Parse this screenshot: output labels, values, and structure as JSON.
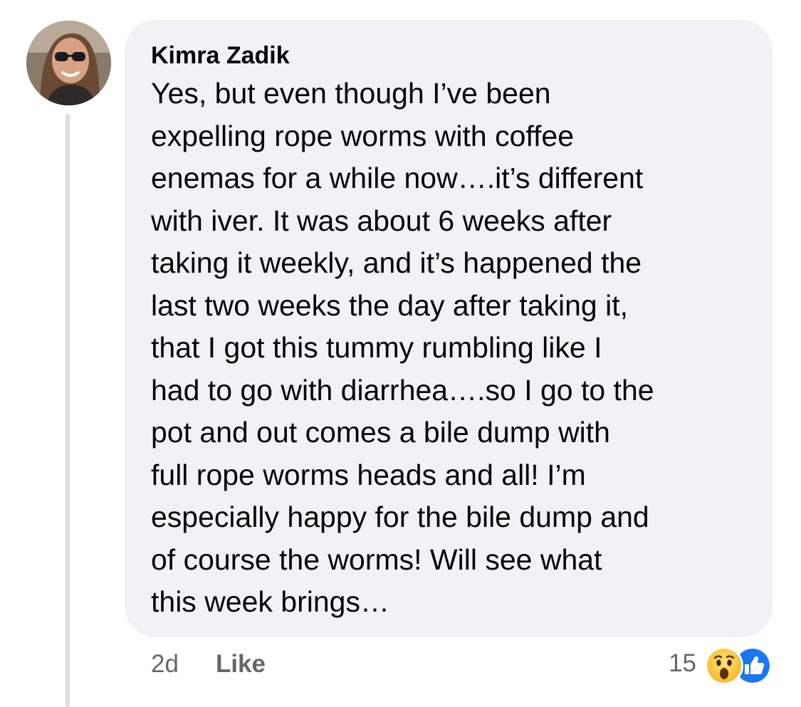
{
  "comment": {
    "author": "Kimra Zadik",
    "text": "Yes, but even though I’ve been\nexpelling rope worms with coffee\nenemas for a while now….it’s different\nwith iver.  It was about 6 weeks after\ntaking it weekly, and it’s happened the\nlast two weeks the day after taking it,\nthat I got this tummy rumbling like I\nhad to go with diarrhea….so I go to the\npot and out comes a bile dump with\nfull rope worms heads and all!  I’m\nespecially happy for the bile dump and\nof course the worms!  Will see what\nthis week brings…",
    "timestamp": "2d",
    "like_label": "Like",
    "reaction_count": "15",
    "reactions": [
      "wow-icon",
      "like-icon"
    ]
  },
  "colors": {
    "bubble": "#f0f2f5",
    "meta_text": "#65676b",
    "like_blue": "#1877f2",
    "wow_yellow": "#f7b928"
  }
}
